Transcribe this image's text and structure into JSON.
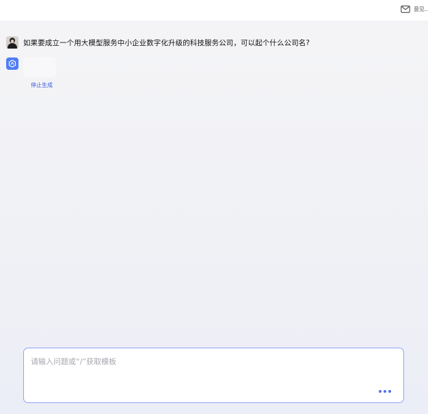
{
  "header": {
    "feedback_label": "意见..."
  },
  "conversation": {
    "user_message": "如果要成立一个用大模型服务中小企业数字化升级的科技服务公司，可以起个什么公司名?",
    "stop_generating_label": "停止生成"
  },
  "composer": {
    "placeholder": "请输入问题或“/”获取模板"
  },
  "icons": {
    "feedback": "mail-icon",
    "bot": "cube-logo-icon",
    "more": "more-dots-icon"
  },
  "colors": {
    "accent": "#4f7cf7",
    "link": "#3b5bdb",
    "input_border": "#8ba3f4"
  }
}
